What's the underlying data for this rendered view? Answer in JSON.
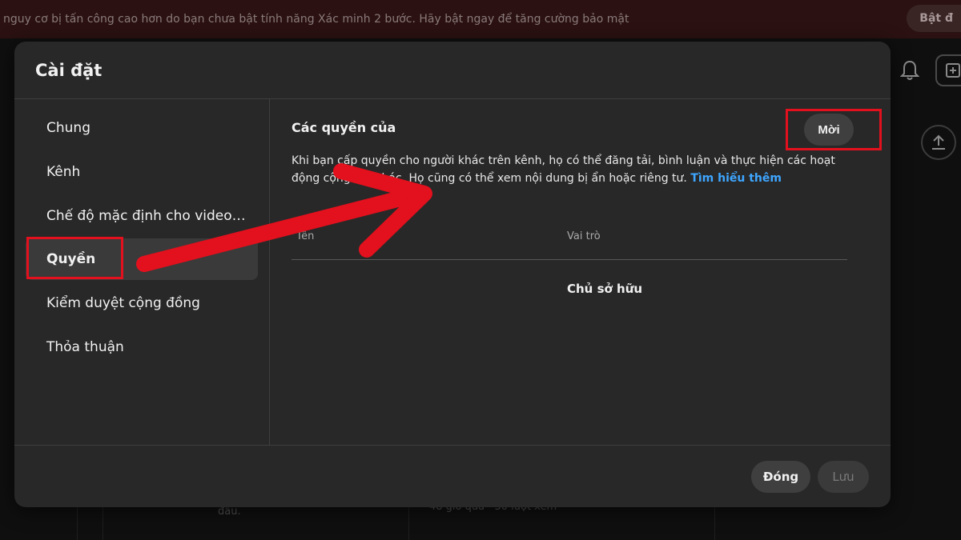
{
  "banner": {
    "text": "nguy cơ bị tấn công cao hơn do bạn chưa bật tính năng Xác minh 2 bước. Hãy bật ngay để tăng cường bảo mật",
    "button_label": "Bật đ"
  },
  "background": {
    "snippet_left": "đầu.",
    "snippet_right": "48 giờ qua · 30 lượt xem"
  },
  "modal": {
    "title": "Cài đặt",
    "sidebar": {
      "items": [
        {
          "label": "Chung"
        },
        {
          "label": "Kênh"
        },
        {
          "label": "Chế độ mặc định cho video…"
        },
        {
          "label": "Quyền",
          "active": true
        },
        {
          "label": "Kiểm duyệt cộng đồng"
        },
        {
          "label": "Thỏa thuận"
        }
      ]
    },
    "content": {
      "title": "Các quyền của",
      "description": "Khi bạn cấp quyền cho người khác trên kênh, họ có thể đăng tải, bình luận và thực hiện các hoạt động cộng tác khác. Họ cũng có thể xem nội dung bị ẩn hoặc riêng tư.",
      "learn_more": "Tìm hiểu thêm",
      "invite_button": "Mời",
      "table": {
        "columns": [
          "Tên",
          "Vai trò"
        ],
        "rows": [
          {
            "name": "",
            "role": "Chủ sở hữu"
          }
        ]
      }
    },
    "footer": {
      "close_label": "Đóng",
      "save_label": "Lưu"
    }
  },
  "colors": {
    "annotation_red": "#e3101d",
    "link_blue": "#3ea6ff",
    "modal_bg": "#282828"
  },
  "icons": [
    "bell-icon",
    "create-plus-icon",
    "upload-icon",
    "annotation-arrow"
  ]
}
